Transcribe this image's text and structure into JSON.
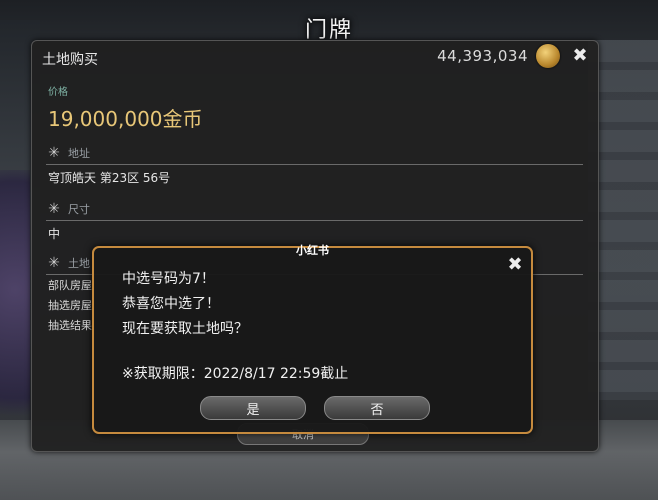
{
  "sign_title": "门牌",
  "window": {
    "title": "土地购买",
    "gil": "44,393,034",
    "price_label": "价格",
    "price": "19,000,000金币",
    "address_label": "地址",
    "address_value": "穹顶皓天 第23区 56号",
    "size_label": "尺寸",
    "size_value": "中",
    "land_label": "土地",
    "land_lines": [
      "部队房屋",
      "抽选房屋",
      "抽选结果"
    ],
    "bottom_button": "取消"
  },
  "dialog": {
    "watermark": "小红书",
    "line1": "中选号码为7！",
    "line2": "恭喜您中选了！",
    "line3": "现在要获取土地吗？",
    "deadline": "※获取期限：2022/8/17 22:59截止",
    "yes_label": "是",
    "no_label": "否"
  },
  "icons": {
    "close": "close-x-icon",
    "section": "sparkle-icon",
    "coin": "gil-coin-icon"
  }
}
